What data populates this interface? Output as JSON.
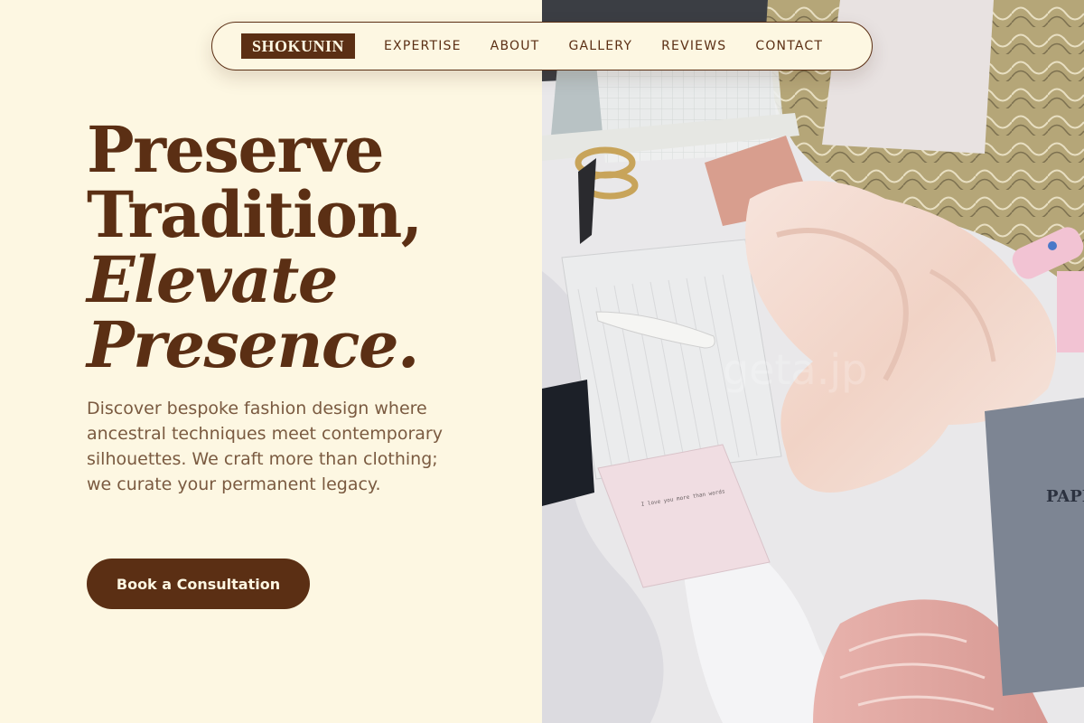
{
  "nav": {
    "logo": "SHOKUNIN",
    "links": [
      "EXPERTISE",
      "ABOUT",
      "GALLERY",
      "REVIEWS",
      "CONTACT"
    ]
  },
  "hero": {
    "headline": {
      "line1": "Preserve",
      "line2": "Tradition,",
      "line3": "Elevate",
      "line4": "Presence."
    },
    "description": "Discover bespoke fashion design where ancestral techniques meet contemporary silhouettes. We craft more than clothing; we curate your permanent legacy.",
    "cta_label": "Book a Consultation"
  },
  "photo": {
    "watermark": "geta.jp",
    "card_text": "I love you more than words",
    "book_title": "PAPER SOURCE"
  },
  "colors": {
    "background": "#fdf7e2",
    "brand_brown": "#5b2f14",
    "body_text": "#7a5a40"
  }
}
